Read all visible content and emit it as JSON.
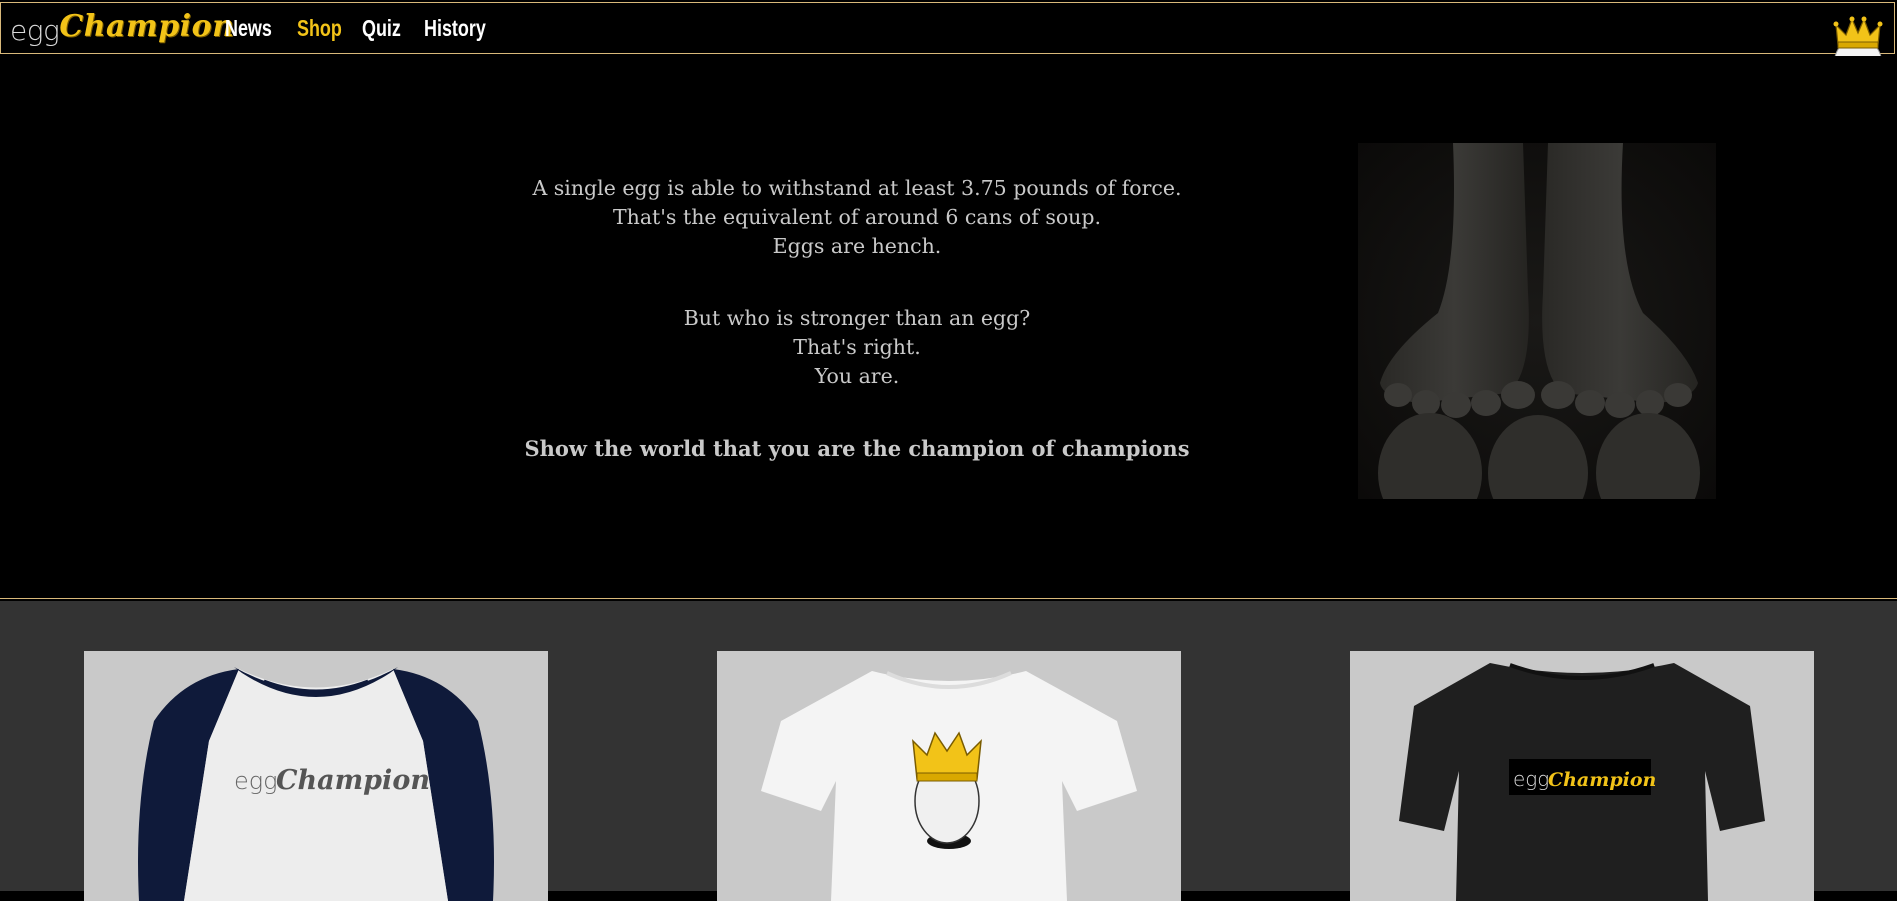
{
  "brand": {
    "logo_egg": "egg",
    "logo_champion": "Champion",
    "accent_color": "#f2c318",
    "border_color": "#d9b97a"
  },
  "nav": {
    "items": [
      {
        "label": "News",
        "active": false
      },
      {
        "label": "Shop",
        "active": true
      },
      {
        "label": "Quiz",
        "active": false
      },
      {
        "label": "History",
        "active": false
      }
    ]
  },
  "hero": {
    "lines_1": [
      "A single egg is able to withstand at least 3.75 pounds of force.",
      "That's the equivalent of around 6 cans of soup.",
      "Eggs are hench."
    ],
    "lines_2": [
      "But who is stronger than an egg?",
      "That's right.",
      "You are."
    ],
    "cta": "Show the world that you are the champion of champions"
  },
  "products": [
    {
      "name": "raglan-shirt",
      "print_egg": "egg",
      "print_champion": "Champion"
    },
    {
      "name": "white-tee-crown-egg"
    },
    {
      "name": "black-tee-logo",
      "print_egg": "egg",
      "print_champion": "Champion"
    }
  ]
}
